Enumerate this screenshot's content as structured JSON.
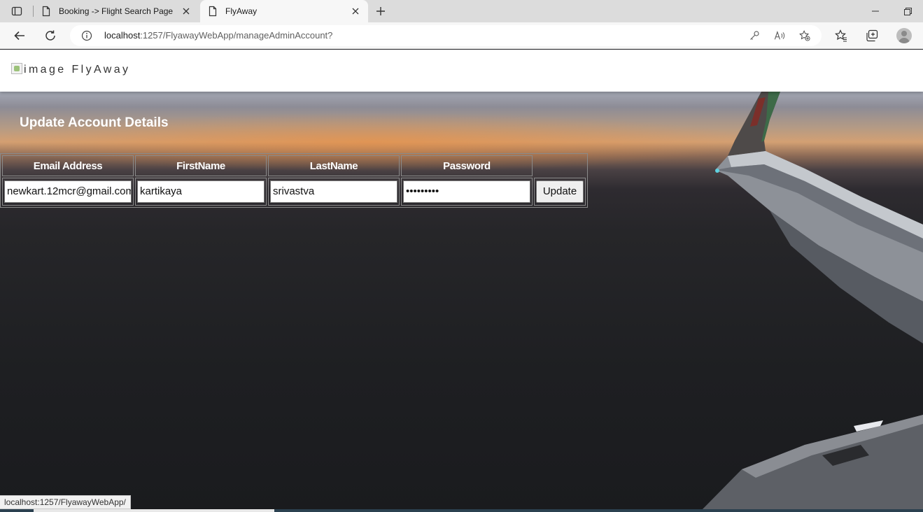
{
  "browser": {
    "tabs": [
      {
        "title": "Booking -> Flight Search Page",
        "active": false
      },
      {
        "title": "FlyAway",
        "active": true
      }
    ],
    "address": {
      "host": "localhost",
      "rest": ":1257/FlyawayWebApp/manageAdminAccount?"
    },
    "status_url": "localhost:1257/FlyawayWebApp/"
  },
  "site": {
    "logo_alt": "image",
    "brand": "FlyAway"
  },
  "main": {
    "heading": "Update Account Details",
    "table": {
      "headers": [
        "Email Address",
        "FirstName",
        "LastName",
        "Password"
      ],
      "row": {
        "email": "newkart.12mcr@gmail.com",
        "first_name": "kartikaya",
        "last_name": "srivastva",
        "password_mask": "•••••••••"
      },
      "update_label": "Update"
    }
  },
  "icons": {
    "tab_actions": "tab-actions-icon",
    "page_favicon": "page-icon",
    "close": "close-icon",
    "new_tab": "plus-icon",
    "back": "back-arrow-icon",
    "refresh": "refresh-icon",
    "info": "info-icon",
    "key": "key-icon",
    "read_aloud": "read-aloud-icon",
    "add_favorite": "add-favorite-icon",
    "favorites": "favorites-icon",
    "collections": "collections-icon",
    "profile": "profile-avatar"
  }
}
